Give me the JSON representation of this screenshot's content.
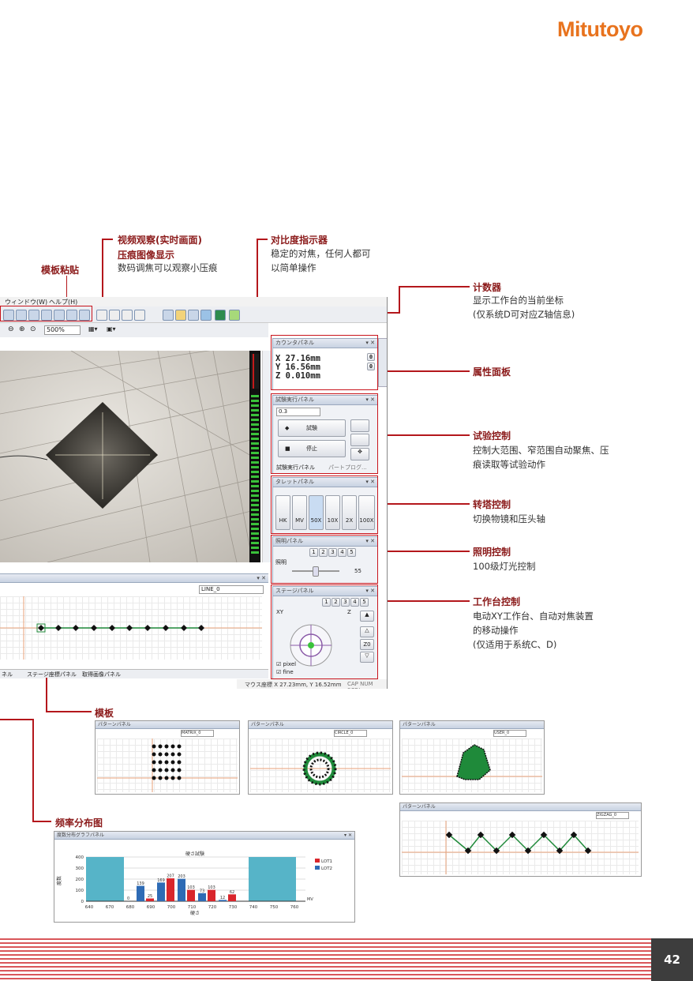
{
  "brand": {
    "logo_text": "Mitutoyo",
    "color": "#e8731e"
  },
  "page_number": "42",
  "annotations": {
    "template_paste": {
      "title": "模板粘贴"
    },
    "video": {
      "title": "视频观察(实时画面)",
      "title2": "压痕图像显示",
      "text": "数码调焦可以观察小压痕"
    },
    "contrast": {
      "title": "对比度指示器",
      "text1": "稳定的对焦，任何人都可",
      "text2": "以简单操作"
    },
    "counter": {
      "title": "计数器",
      "text1": "显示工作台的当前坐标",
      "text2": "(仅系统D可对应Z轴信息)"
    },
    "property": {
      "title": "属性面板"
    },
    "test": {
      "title": "试验控制",
      "text1": "控制大范围、窄范围自动聚焦、压",
      "text2": "痕读取等试验动作"
    },
    "turret": {
      "title": "转塔控制",
      "text": "切换物镜和压头轴"
    },
    "lighting": {
      "title": "照明控制",
      "text": "100级灯光控制"
    },
    "stage": {
      "title": "工作台控制",
      "text1": "电动XY工作台、自动对焦装置",
      "text2": "的移动操作",
      "text3": "(仅适用于系统C、D)"
    },
    "template": {
      "title": "模板"
    },
    "histogram": {
      "title": "频率分布图"
    }
  },
  "app": {
    "menu": [
      "ウィンドウ(W)",
      "ヘルプ(H)"
    ],
    "zoom": "500%",
    "counter_panel": {
      "title": "カウンタパネル",
      "x": "X  27.16mm",
      "y": "Y  16.56mm",
      "z": "Z  0.010mm",
      "btn": "0"
    },
    "test_panel": {
      "title": "試験実行パネル",
      "value": "0.3",
      "test_btn": "試験",
      "stop_btn": "停止",
      "tab1": "試験実行パネル",
      "tab2": "パートプログ..."
    },
    "turret_panel": {
      "title": "タレットパネル",
      "items": [
        "HK",
        "MV",
        "50X",
        "10X",
        "2X",
        "100X"
      ]
    },
    "light_panel": {
      "title": "照明パネル",
      "label": "照明",
      "value": "55",
      "presets": [
        "1",
        "2",
        "3",
        "4",
        "5"
      ]
    },
    "stage_panel": {
      "title": "ステージパネル",
      "xy": "XY",
      "z": "Z",
      "z0": "Z0",
      "pixel": "pixel",
      "fine": "fine",
      "presets": [
        "1",
        "2",
        "3",
        "4",
        "5"
      ]
    },
    "pattern_select": "LINE_0",
    "lower_tabs": [
      "ネル",
      "ステージ座標パネル",
      "取得画像パネル"
    ],
    "status": {
      "mouse": "マウス座標 X 27.23mm, Y 16.52mm",
      "cap": "CAP  NUM  SCRL"
    }
  },
  "templates": {
    "panel_title": "パターンパネル",
    "selects": [
      "MATRIX_0",
      "CIRCLE_0",
      "USER_0",
      "ZIGZAG_0"
    ]
  },
  "histogram_panel": {
    "title": "度数分布グラフパネル",
    "chart_data": {
      "type": "bar",
      "title": "硬さ試験",
      "xlabel": "硬さ",
      "ylabel": "度数",
      "x_ticks": [
        "640",
        "670",
        "680",
        "690",
        "700",
        "710",
        "720",
        "730",
        "740",
        "750",
        "760"
      ],
      "y_ticks": [
        "0",
        "100",
        "200",
        "300",
        "400"
      ],
      "ylim": [
        0,
        400
      ],
      "series": [
        {
          "name": "LOT1",
          "color": "#d9262c",
          "values": [
            25,
            207,
            103,
            103,
            62
          ]
        },
        {
          "name": "LOT2",
          "color": "#2e6bb5",
          "values": [
            139,
            169,
            203,
            73,
            12
          ]
        }
      ],
      "other_labels": [
        "0",
        "MV"
      ],
      "legend": "right"
    }
  },
  "colors": {
    "accent_red": "#b4171c",
    "stripe": "#d9565a",
    "pattern_green": "#1f8a3a"
  }
}
